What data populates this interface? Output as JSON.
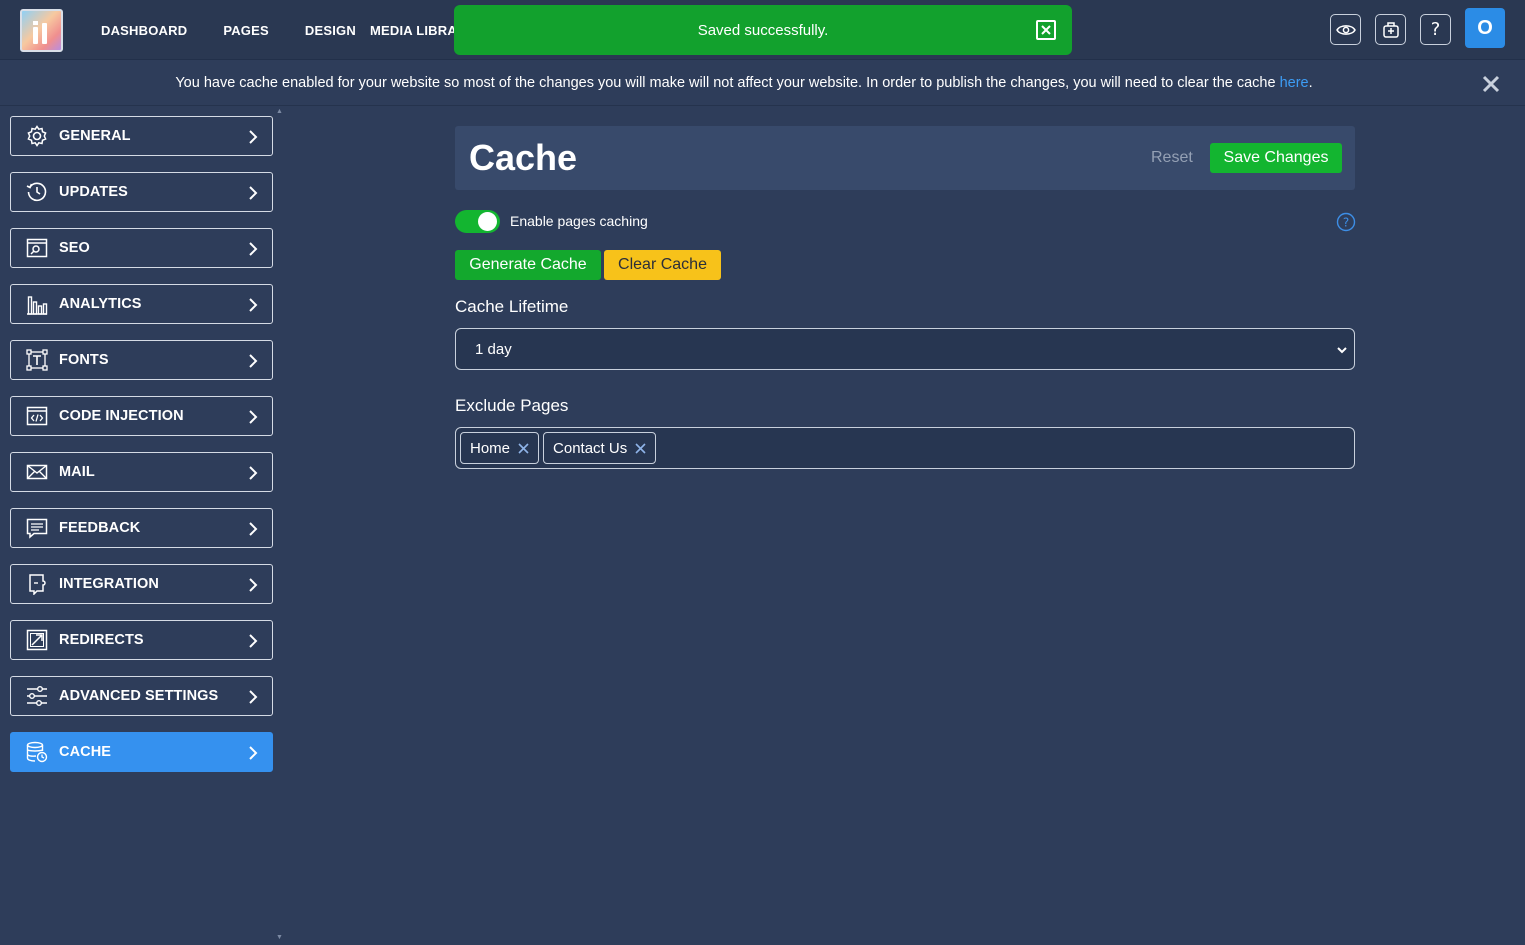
{
  "topbar": {
    "nav": [
      "DASHBOARD",
      "PAGES",
      "DESIGN",
      "MEDIA LIBRARY"
    ],
    "toast": "Saved successfully.",
    "avatar_letter": "O",
    "icons": [
      "eye-icon",
      "plugin-icon",
      "help-icon"
    ]
  },
  "notice": {
    "text": "You have cache enabled for your website so most of the changes you will make will not affect your website. In order to publish the changes, you will need to clear the cache ",
    "link": "here",
    "suffix": "."
  },
  "sidebar": {
    "items": [
      {
        "label": "GENERAL",
        "icon": "gear-icon"
      },
      {
        "label": "UPDATES",
        "icon": "history-icon"
      },
      {
        "label": "SEO",
        "icon": "seo-icon"
      },
      {
        "label": "ANALYTICS",
        "icon": "analytics-icon"
      },
      {
        "label": "FONTS",
        "icon": "fonts-icon"
      },
      {
        "label": "CODE INJECTION",
        "icon": "code-icon"
      },
      {
        "label": "MAIL",
        "icon": "mail-icon"
      },
      {
        "label": "FEEDBACK",
        "icon": "feedback-icon"
      },
      {
        "label": "INTEGRATION",
        "icon": "integration-icon"
      },
      {
        "label": "REDIRECTS",
        "icon": "redirect-icon"
      },
      {
        "label": "ADVANCED SETTINGS",
        "icon": "sliders-icon"
      },
      {
        "label": "CACHE",
        "icon": "database-icon",
        "active": true
      }
    ]
  },
  "main": {
    "title": "Cache",
    "reset_label": "Reset",
    "save_label": "Save Changes",
    "toggle_label": "Enable pages caching",
    "toggle_on": true,
    "generate_label": "Generate Cache",
    "clear_label": "Clear Cache",
    "lifetime_label": "Cache Lifetime",
    "lifetime_value": "1 day",
    "exclude_label": "Exclude Pages",
    "exclude_tags": [
      "Home",
      "Contact Us"
    ]
  },
  "colors": {
    "background": "#2e3d5a",
    "accent_blue": "#3591ef",
    "success_green": "#13b530",
    "warning_yellow": "#f7c21a"
  }
}
